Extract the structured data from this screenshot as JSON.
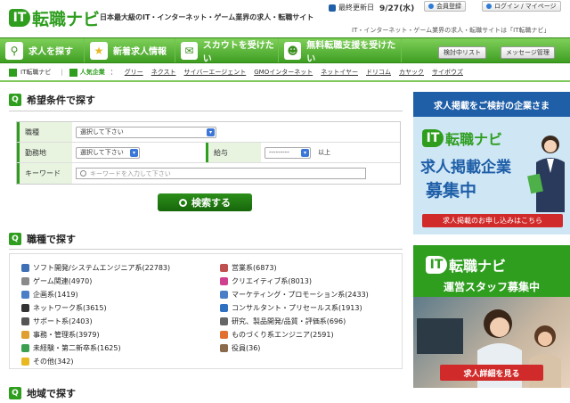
{
  "header": {
    "logo_it": "IT",
    "logo_text": "転職ナビ",
    "tagline": "日本最大級のIT・インターネット・ゲーム業界の求人・転職サイト",
    "updated_label": "最終更新日",
    "updated_date": "9/27(水)",
    "member_register": "会員登録",
    "login": "ログイン / マイページ",
    "subtagline": "IT・インターネット・ゲーム業界の求人・転職サイトは「IT転職ナビ」"
  },
  "nav": {
    "items": [
      {
        "label": "求人を探す",
        "icon": "search-icon"
      },
      {
        "label": "新着求人情報",
        "icon": "star-icon"
      },
      {
        "label": "スカウトを受けたい",
        "icon": "scout-icon"
      },
      {
        "label": "無料転職支援を受けたい",
        "icon": "support-icon"
      }
    ],
    "saved_list": "検討中リスト",
    "message_management": "メッセージ管理"
  },
  "breadcrumb": {
    "home": "IT転職ナビ",
    "popular_label": "人気企業",
    "companies": [
      "グリー",
      "ネクスト",
      "サイバーエージェント",
      "GMOインターネット",
      "ネットイヤー",
      "ドリコム",
      "カヤック",
      "サイボウズ"
    ]
  },
  "search": {
    "title": "希望条件で探す",
    "occupation_label": "職種",
    "occupation_value": "選択して下さい",
    "location_label": "勤務地",
    "location_value": "選択して下さい",
    "salary_label": "給与",
    "salary_value": "---------",
    "salary_suffix": "以上",
    "keyword_label": "キーワード",
    "keyword_placeholder": "キーワードを入力して下さい",
    "button": "検索する"
  },
  "occupations": {
    "title": "職種で探す",
    "left": [
      {
        "label": "ソフト開発/システムエンジニア系(22783)",
        "color": "#3f6fb5"
      },
      {
        "label": "ゲーム関連(4970)",
        "color": "#8a8a8a"
      },
      {
        "label": "企画系(1419)",
        "color": "#4a7fc8"
      },
      {
        "label": "ネットワーク系(3615)",
        "color": "#333333"
      },
      {
        "label": "サポート系(2403)",
        "color": "#555555"
      },
      {
        "label": "事務・管理系(3979)",
        "color": "#e0a030"
      },
      {
        "label": "未経験・第二新卒系(1625)",
        "color": "#3aa050"
      },
      {
        "label": "その他(342)",
        "color": "#e8b820"
      }
    ],
    "right": [
      {
        "label": "営業系(6873)",
        "color": "#c05050"
      },
      {
        "label": "クリエイティブ系(8013)",
        "color": "#d04090"
      },
      {
        "label": "マーケティング・プロモーション系(2433)",
        "color": "#4a7fc8"
      },
      {
        "label": "コンサルタント・プリセールス系(1913)",
        "color": "#3070c0"
      },
      {
        "label": "研究、製品開発/品質・評価系(696)",
        "color": "#666666"
      },
      {
        "label": "ものづくり系エンジニア(2591)",
        "color": "#e07030"
      },
      {
        "label": "役員(36)",
        "color": "#8a6a4a"
      }
    ]
  },
  "region": {
    "title": "地域で探す"
  },
  "banner1": {
    "head": "求人掲載をご検討の企業さま",
    "line1": "求人掲載企業",
    "line2": "募集中",
    "button": "求人掲載のお申し込みはこちら"
  },
  "banner2": {
    "headline": "運営スタッフ募集中",
    "button": "求人詳細を見る"
  }
}
